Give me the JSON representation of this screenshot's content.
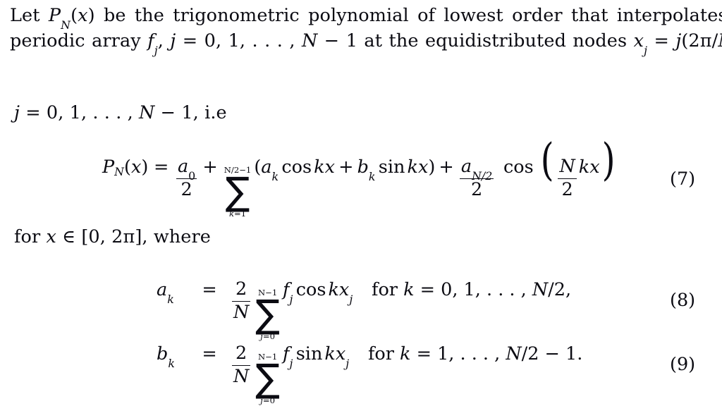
{
  "document": {
    "type": "mathematical-text-excerpt",
    "background_color": "#ffffff",
    "text_color": "#0b0b12",
    "intro_paragraph": {
      "line1": {
        "t1": "Let ",
        "P": "P",
        "Psub": "N",
        "paren_open": "(",
        "x": "x",
        "paren_close": ")",
        "t2": " be the trigonometric polynomial of lowest order that interpolates the"
      },
      "line2": {
        "t1": "periodic array ",
        "f": "f",
        "fsub": "j",
        "comma1": ", ",
        "j": "j",
        "eq": " = ",
        "range": "0, 1, . . . , ",
        "N": "N",
        "minus": " − ",
        "one": "1",
        "t2": " at the equidistributed nodes ",
        "x": "x",
        "xsub": "j",
        "eq2": " = ",
        "j2": "j",
        "expr": "(2π/",
        "N2": "N",
        "expr_close": "),"
      }
    },
    "condition_line": {
      "j": "j",
      "eq": " = ",
      "range": "0, 1, . . . , ",
      "N": "N",
      "minus": " − ",
      "one": "1, ",
      "ie": "i.e"
    },
    "equation_7": {
      "tag": "(7)",
      "lhs": {
        "P": "P",
        "sub": "N",
        "open": "(",
        "x": "x",
        "close": ")"
      },
      "eq": "=",
      "term1_frac": {
        "numerator": "a",
        "numerator_sub": "0",
        "denominator": "2"
      },
      "plus1": "+",
      "sum": {
        "upper": "N/2−1",
        "lower_var": "k",
        "lower_eq": "=",
        "lower_val": "1"
      },
      "summand": {
        "open": "(",
        "a": "a",
        "a_sub": "k",
        "cos": "cos",
        "kx1": "kx",
        "plus": "+",
        "b": "b",
        "b_sub": "k",
        "sin": "sin",
        "kx2": "kx",
        "close": ")"
      },
      "plus2": "+",
      "term3_frac": {
        "numerator": "a",
        "numerator_sub": "N/2",
        "denominator": "2"
      },
      "cos": "cos",
      "arg_frac": {
        "numerator": "N",
        "denominator": "2"
      },
      "arg_tail": "kx"
    },
    "where_line": {
      "for": "for ",
      "x": "x",
      "in": " ∈ ",
      "interval": "[0, 2π]",
      "comma": ", ",
      "where": "where"
    },
    "equation_8": {
      "tag": "(8)",
      "lhs": {
        "sym": "a",
        "sub": "k"
      },
      "eq": "=",
      "frac": {
        "numerator": "2",
        "denominator": "N"
      },
      "sum": {
        "upper": "N−1",
        "lower_var": "j",
        "lower_eq": "=",
        "lower_val": "0"
      },
      "summand": {
        "f": "f",
        "f_sub": "j",
        "fn": "cos",
        "arg": "kx",
        "arg_sub": "j"
      },
      "condition": {
        "for": "for ",
        "k": "k",
        "eq": " = ",
        "values": "0, 1, . . . , ",
        "N": "N",
        "tail": "/2,"
      }
    },
    "equation_9": {
      "tag": "(9)",
      "lhs": {
        "sym": "b",
        "sub": "k"
      },
      "eq": "=",
      "frac": {
        "numerator": "2",
        "denominator": "N"
      },
      "sum": {
        "upper": "N−1",
        "lower_var": "j",
        "lower_eq": "=",
        "lower_val": "0"
      },
      "summand": {
        "f": "f",
        "f_sub": "j",
        "fn": "sin",
        "arg": "kx",
        "arg_sub": "j"
      },
      "condition": {
        "for": "for ",
        "k": "k",
        "eq": " = ",
        "values": "1, . . . , ",
        "N": "N",
        "tail": "/2 − 1."
      }
    }
  }
}
